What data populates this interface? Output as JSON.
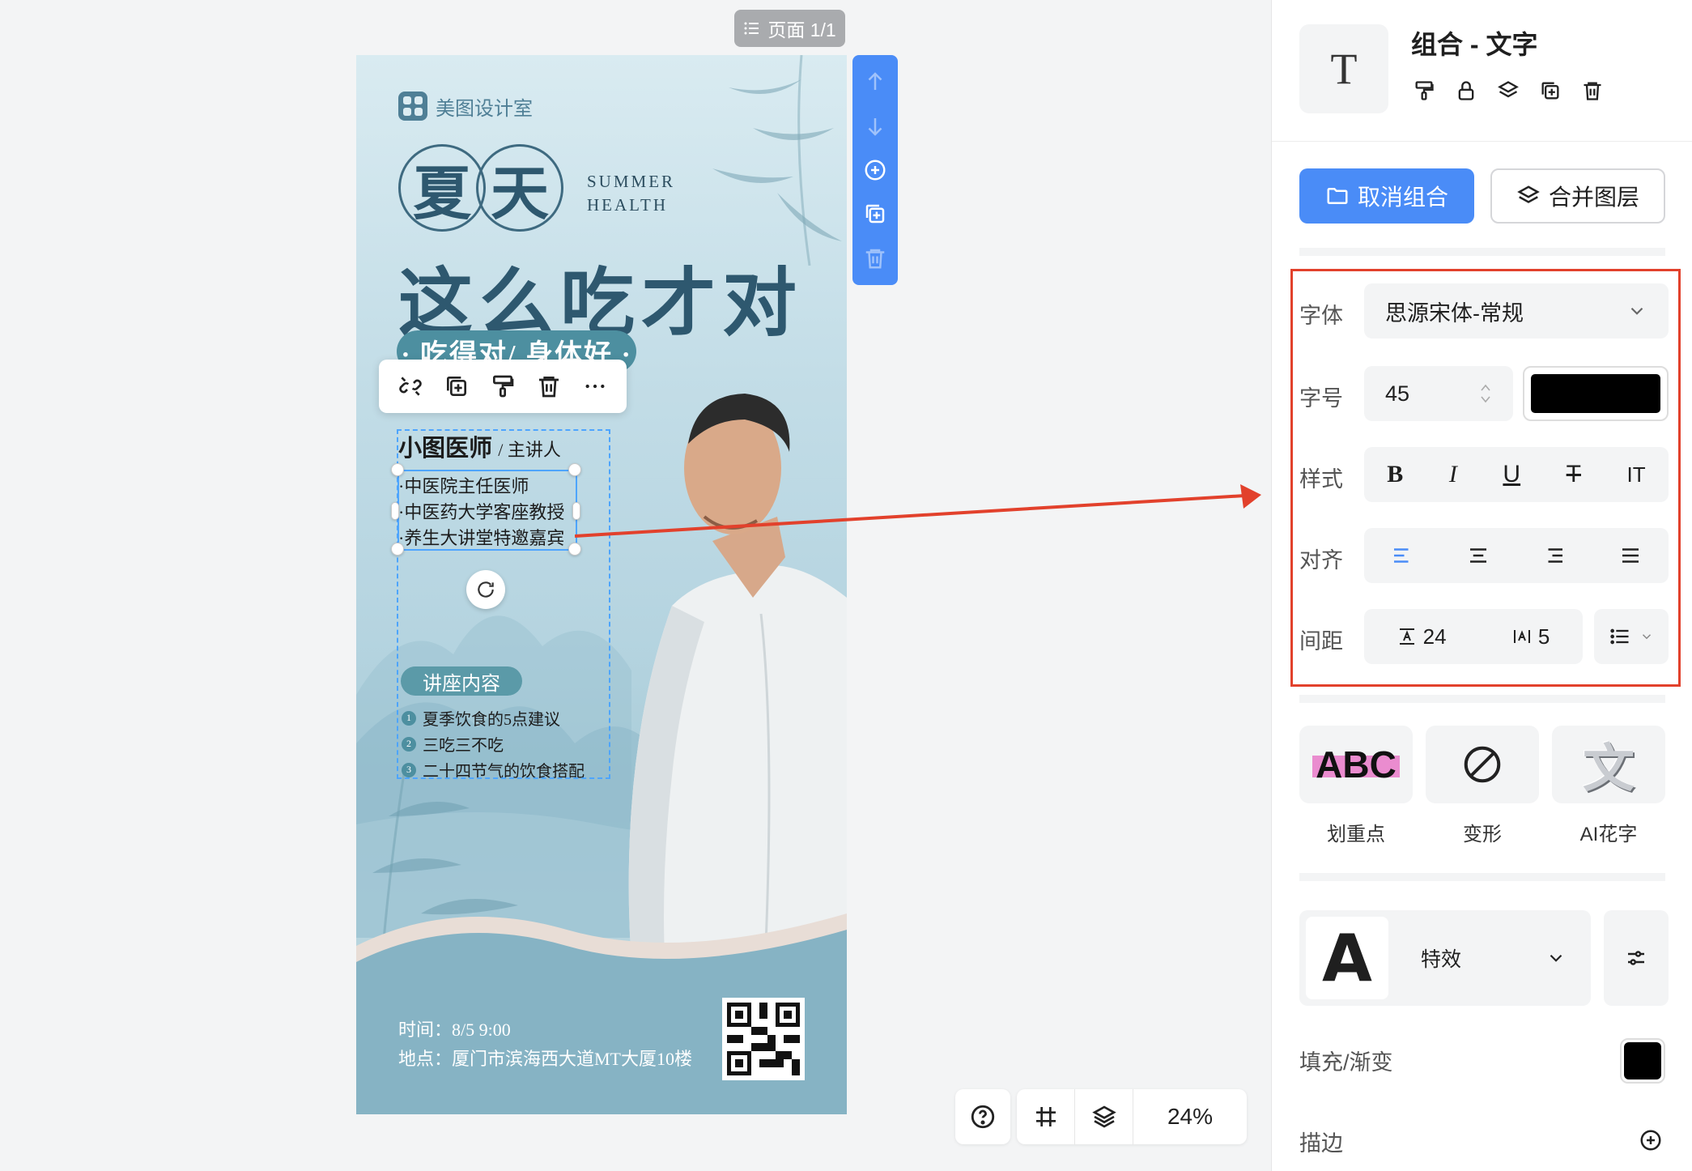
{
  "canvas": {
    "page_indicator": "页面 1/1",
    "zoom": "24%"
  },
  "poster": {
    "brand": "美图设计室",
    "title_chars": [
      "夏",
      "天"
    ],
    "summer_line1": "SUMMER",
    "summer_line2": "HEALTH",
    "headline": "这么吃才对",
    "slogan": "· 吃得对/ 身体好 ·",
    "doctor_name": "小图医师",
    "doctor_role": "/ 主讲人",
    "credentials": [
      "·中医院主任医师",
      "·中医药大学客座教授",
      "·养生大讲堂特邀嘉宾"
    ],
    "lecture_tag": "讲座内容",
    "topics": [
      {
        "num": "1",
        "text": "夏季饮食的5点建议"
      },
      {
        "num": "2",
        "text": "三吃三不吃"
      },
      {
        "num": "3",
        "text": "二十四节气的饮食搭配"
      }
    ],
    "time": "时间：8/5 9:00",
    "address": "地点：厦门市滨海西大道MT大厦10楼",
    "colors": {
      "accent": "#4d8fa0",
      "title": "#2e586f",
      "wave": "#86b3c4"
    }
  },
  "panel": {
    "type_icon": "T",
    "title": "组合 - 文字",
    "ungroup_label": "取消组合",
    "merge_label": "合并图层",
    "labels": {
      "font": "字体",
      "size": "字号",
      "style": "样式",
      "align": "对齐",
      "spacing": "间距"
    },
    "font_value": "思源宋体-常规",
    "size_value": "45",
    "text_color": "#000000",
    "style_bold": "B",
    "style_italic": "I",
    "style_underline": "U",
    "style_strike": "T",
    "style_vertical": "IT",
    "line_spacing": "24",
    "letter_spacing": "5",
    "tiles": [
      {
        "preview": "ABC",
        "label": "划重点"
      },
      {
        "preview": "⊘",
        "label": "变形"
      },
      {
        "preview": "文",
        "label": "AI花字"
      }
    ],
    "effect_preview": "A",
    "effect_label": "特效",
    "fill_label": "填充/渐变",
    "fill_color": "#000000",
    "stroke_label": "描边",
    "accent": "#4a8cf7",
    "highlight_color": "#e2412c"
  }
}
